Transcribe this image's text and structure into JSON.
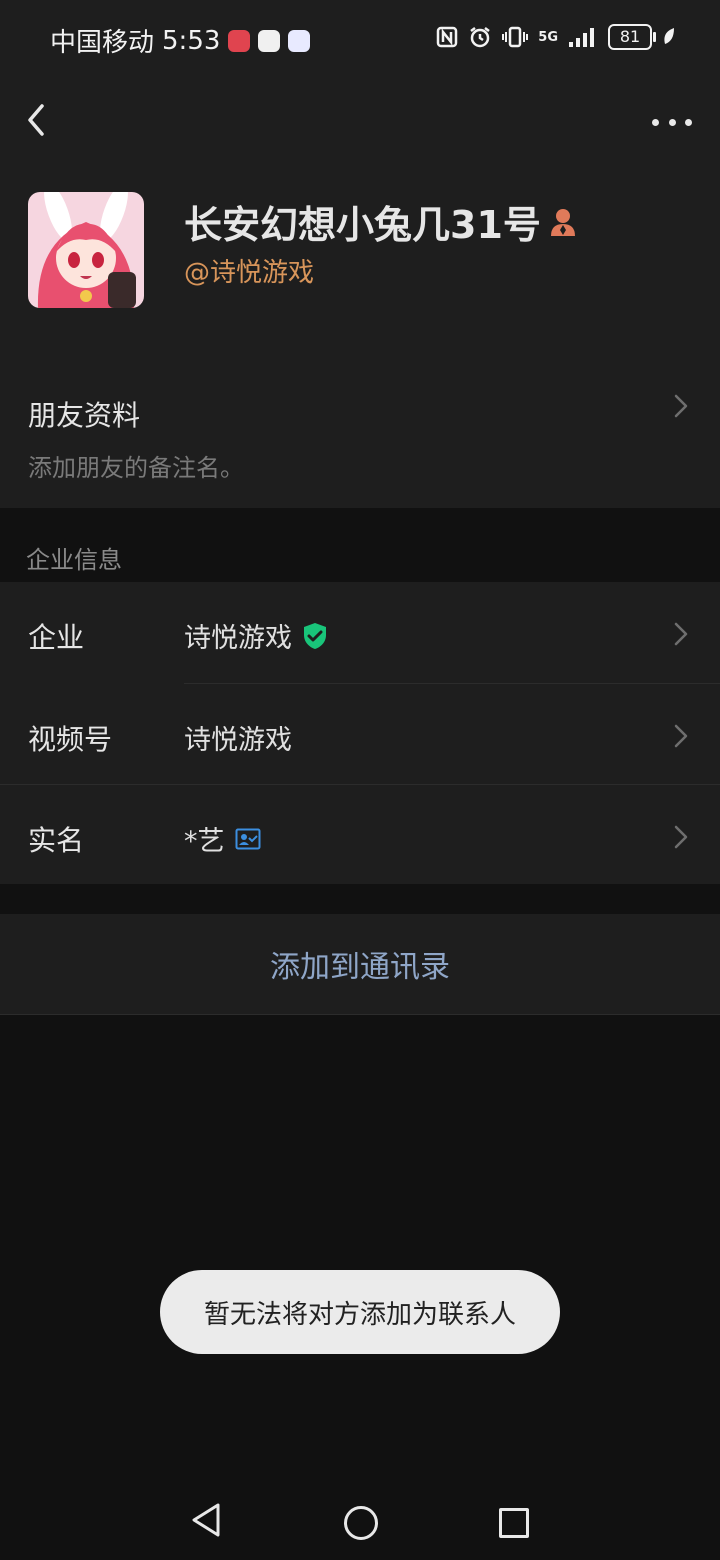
{
  "status_bar": {
    "carrier": "中国移动",
    "time": "5:53",
    "battery": "81",
    "network": "5G"
  },
  "header": {
    "back_icon": "chevron-left-icon",
    "more_icon": "more-dots-icon"
  },
  "profile": {
    "name": "长安幻想小兔几31号",
    "corp_handle": "@诗悦游戏",
    "badge_icon": "work-person-icon",
    "badge_color": "#e07a5a"
  },
  "friend_section": {
    "title": "朋友资料",
    "subtitle": "添加朋友的备注名。"
  },
  "corp_section": {
    "header": "企业信息",
    "rows": [
      {
        "label": "企业",
        "value": "诗悦游戏",
        "icon": "verified-shield-icon"
      },
      {
        "label": "视频号",
        "value": "诗悦游戏"
      },
      {
        "label": "实名",
        "value": "*艺",
        "icon": "id-card-icon"
      }
    ]
  },
  "actions": {
    "add_contact": "添加到通讯录"
  },
  "toast": {
    "message": "暂无法将对方添加为联系人"
  },
  "colors": {
    "accent_orange": "#d8955a",
    "link_blue": "#8fa6c8",
    "verified_green": "#19c47a",
    "idcard_blue": "#3c8fe0"
  }
}
